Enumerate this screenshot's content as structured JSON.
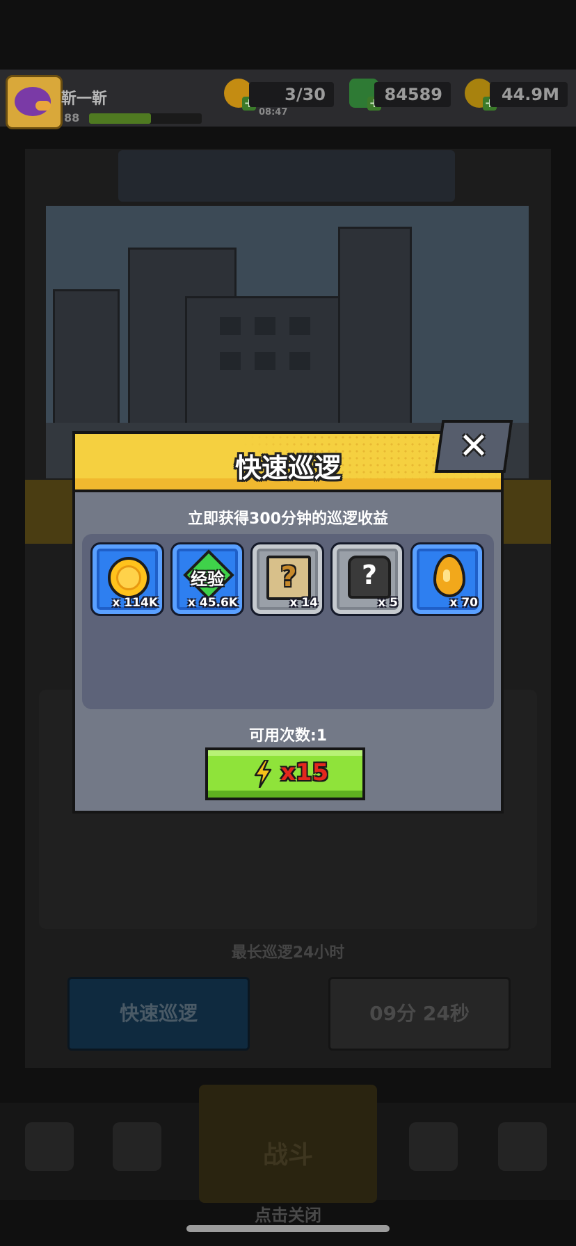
{
  "top_bar": {
    "player_name": "靳一靳",
    "player_level": "88",
    "xp_fraction": 0.55,
    "energy": "3/30",
    "energy_timer": "08:47",
    "gems": "84589",
    "gold": "44.9M",
    "energy_icon": "lightning-icon",
    "gem_icon": "green-gem-icon",
    "gold_icon": "gold-coin-icon"
  },
  "background": {
    "max_patrol_text": "最长巡逻24小时",
    "quick_patrol_btn": "快速巡逻",
    "countdown_btn": "09分 24秒",
    "battle_label": "战斗",
    "tap_to_close": "点击关闭"
  },
  "dialog": {
    "title": "快速巡逻",
    "close_label": "✕",
    "subtitle": "立即获得300分钟的巡逻收益",
    "rewards": [
      {
        "icon": "gold-coin-icon",
        "quantity": "x 114K"
      },
      {
        "icon": "exp-gem-icon",
        "label": "经验",
        "quantity": "x 45.6K"
      },
      {
        "icon": "mystery-scroll-icon",
        "label": "?",
        "quantity": "x 14"
      },
      {
        "icon": "mystery-shirt-icon",
        "label": "?",
        "quantity": "x 5"
      },
      {
        "icon": "oil-drop-icon",
        "quantity": "x 70"
      }
    ],
    "uses_remaining": "可用次数:1",
    "confirm_button": {
      "icon": "lightning-icon",
      "cost": "x15"
    }
  },
  "colors": {
    "header_yellow": "#f5d040",
    "dialog_body": "#737987",
    "confirm_green": "#8fe33a",
    "cost_red": "#e3281e",
    "item_blue": "#2e7ff0",
    "item_grey": "#9aa0a8"
  }
}
